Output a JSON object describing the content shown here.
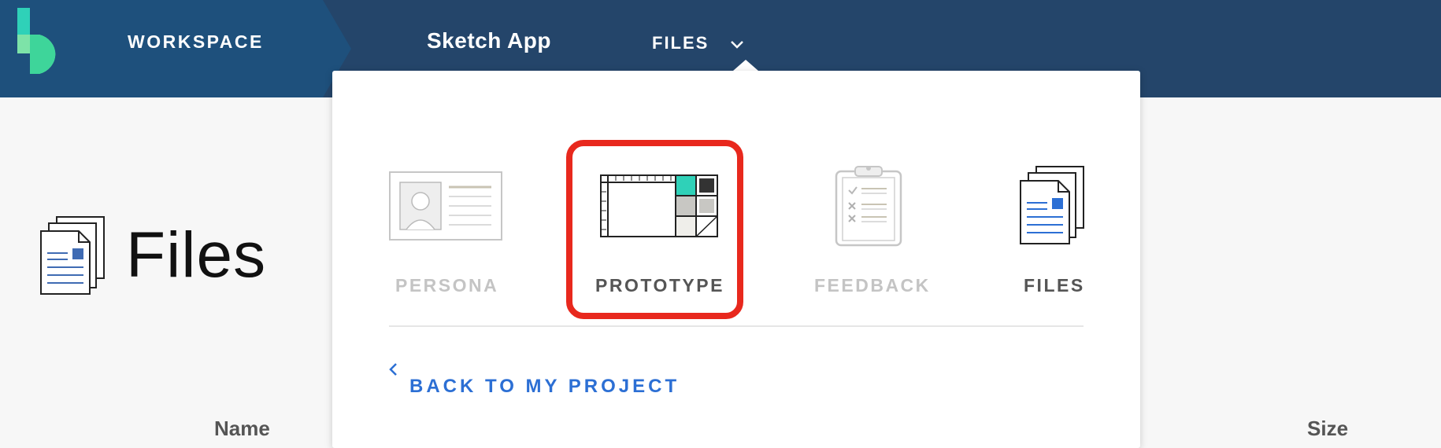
{
  "topbar": {
    "workspace_label": "WORKSPACE",
    "app_name": "Sketch App",
    "files_label": "FILES"
  },
  "dropdown": {
    "items": [
      {
        "label": "PERSONA",
        "state": "disabled"
      },
      {
        "label": "PROTOTYPE",
        "state": "highlighted"
      },
      {
        "label": "FEEDBACK",
        "state": "disabled"
      },
      {
        "label": "FILES",
        "state": "active"
      }
    ],
    "back_link": "BACK TO MY PROJECT"
  },
  "page": {
    "title": "Files",
    "columns": {
      "name": "Name",
      "size": "Size"
    }
  },
  "colors": {
    "topbar": "#24456a",
    "workspace": "#1e507c",
    "highlight": "#e8281d",
    "link": "#2c6fd4",
    "teal": "#2fd1b8"
  }
}
